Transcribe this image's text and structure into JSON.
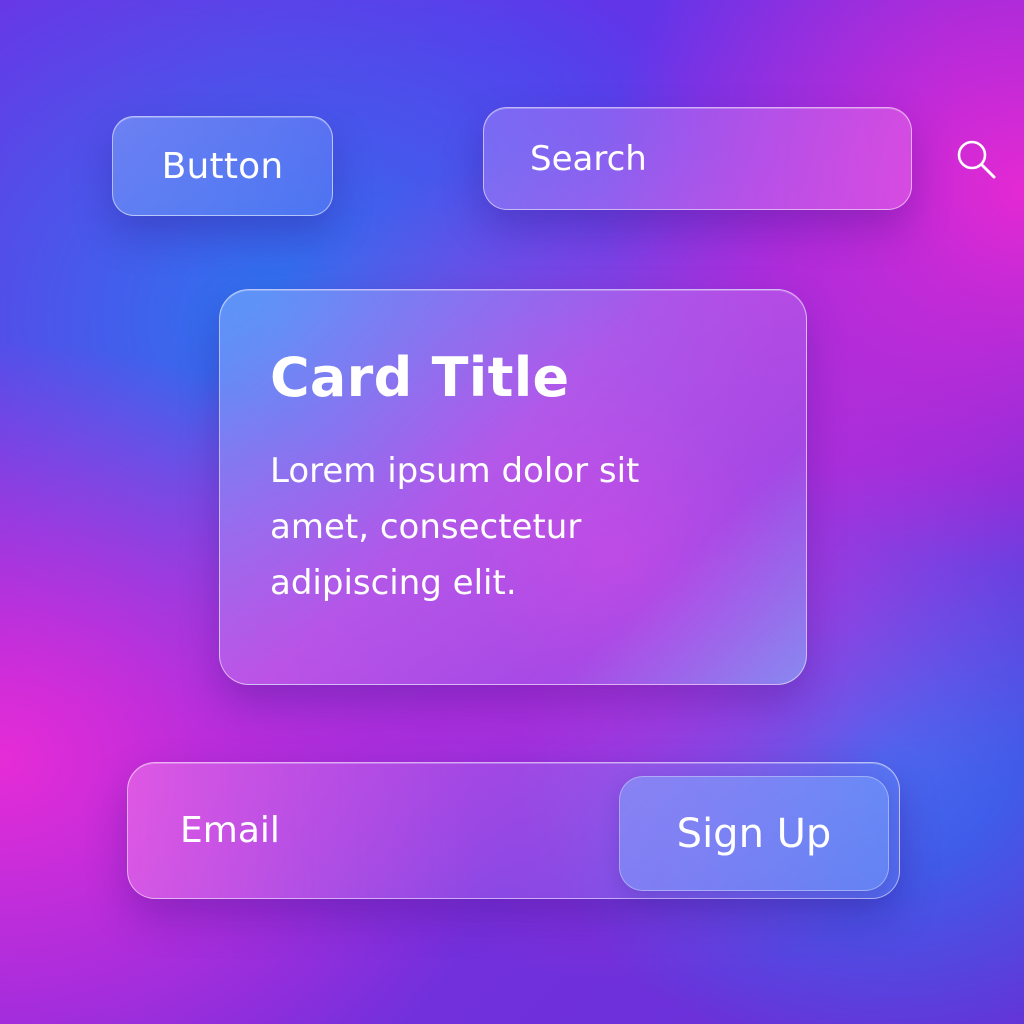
{
  "button": {
    "label": "Button"
  },
  "search": {
    "placeholder": "Search",
    "icon": "search-icon"
  },
  "card": {
    "title": "Card Title",
    "body": "Lorem ipsum dolor sit amet, consectetur adipiscing elit."
  },
  "signup": {
    "email_placeholder": "Email",
    "button_label": "Sign Up"
  },
  "colors": {
    "text": "#ffffff",
    "background_blue": "#2878f0",
    "background_magenta": "#ec2cd6",
    "background_violet": "#6a34e6"
  }
}
